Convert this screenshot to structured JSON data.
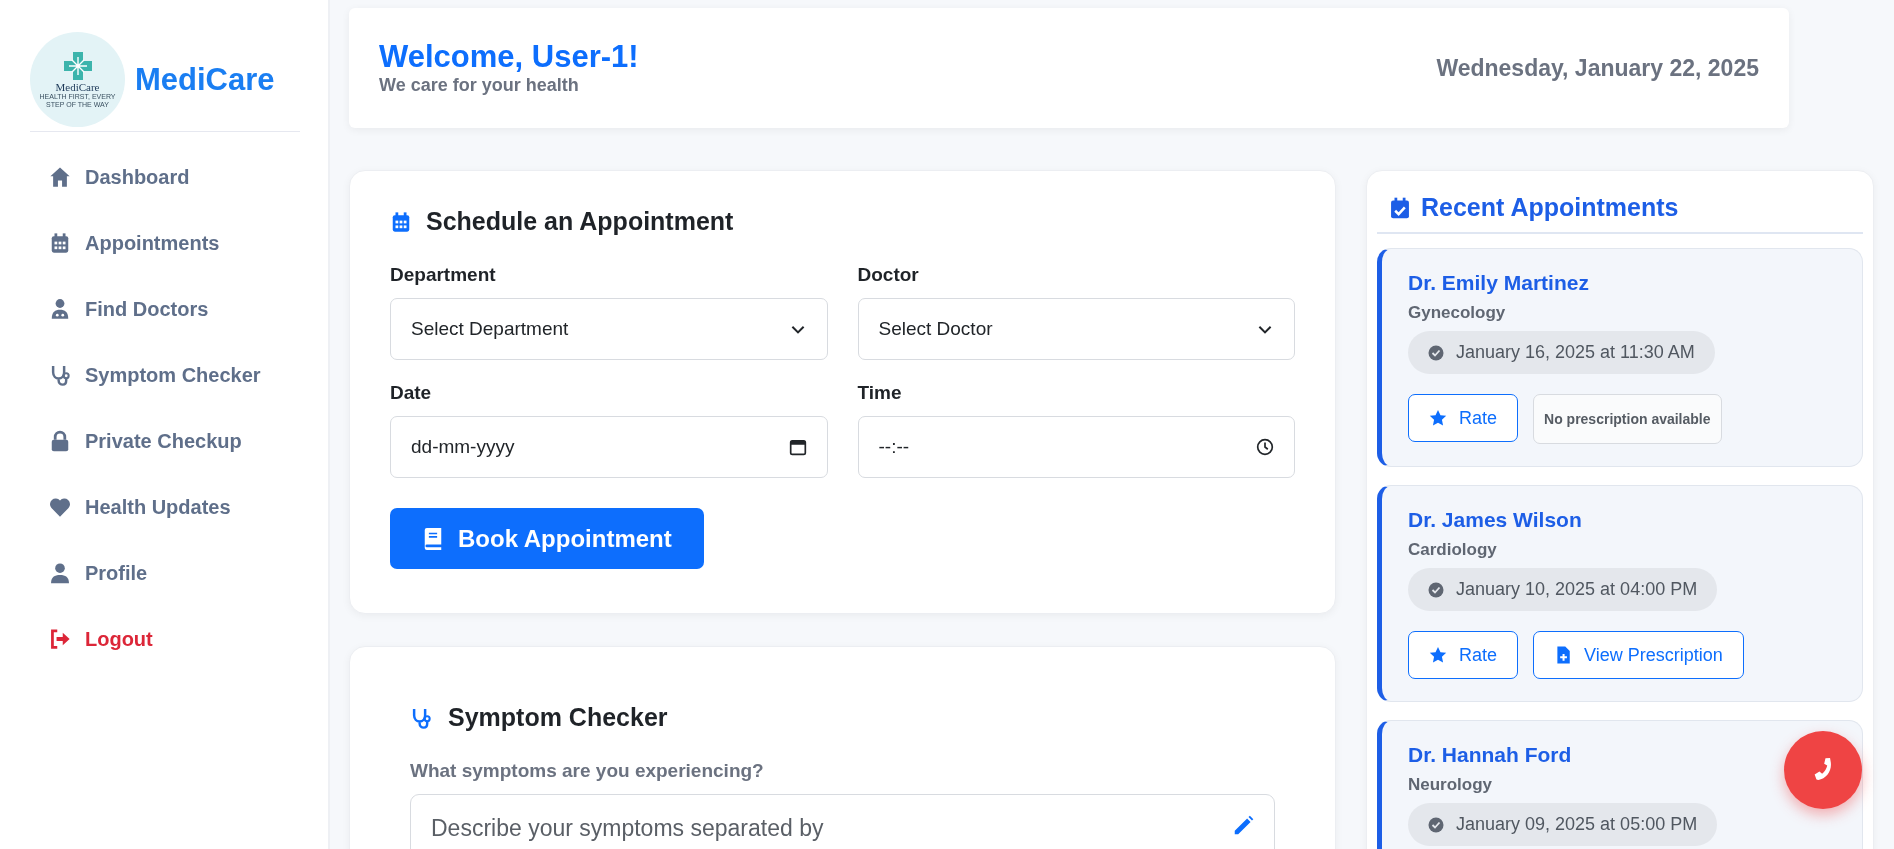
{
  "sidebar": {
    "brand": "MediCare",
    "logo": {
      "name": "MediCare",
      "tagline": "HEALTH FIRST, EVERY STEP OF THE WAY"
    },
    "items": [
      {
        "label": "Dashboard",
        "kind": "link"
      },
      {
        "label": "Appointments",
        "kind": "link"
      },
      {
        "label": "Find Doctors",
        "kind": "link"
      },
      {
        "label": "Symptom Checker",
        "kind": "link"
      },
      {
        "label": "Private Checkup",
        "kind": "link"
      },
      {
        "label": "Health Updates",
        "kind": "link"
      },
      {
        "label": "Profile",
        "kind": "link"
      },
      {
        "label": "Logout",
        "kind": "logout"
      }
    ]
  },
  "header": {
    "welcome": "Welcome, User-1!",
    "subtitle": "We care for your health",
    "date": "Wednesday, January 22, 2025"
  },
  "schedule": {
    "title": "Schedule an Appointment",
    "fields": [
      {
        "label": "Department",
        "kind": "select",
        "placeholder": "Select Department"
      },
      {
        "label": "Doctor",
        "kind": "select",
        "placeholder": "Select Doctor"
      },
      {
        "label": "Date",
        "kind": "date",
        "placeholder": "dd-mm-yyyy"
      },
      {
        "label": "Time",
        "kind": "time",
        "placeholder": "--:--"
      }
    ],
    "button": "Book Appointment"
  },
  "symptom_checker": {
    "title": "Symptom Checker",
    "label": "What symptoms are you experiencing?",
    "placeholder": "Describe your symptoms separated by"
  },
  "recent": {
    "title": "Recent Appointments",
    "appointments": [
      {
        "doctor": "Dr. Emily Martinez",
        "department": "Gynecology",
        "when": "January 16, 2025 at 11:30 AM",
        "rate": "Rate",
        "prescription": {
          "available": false,
          "label": "No prescription available"
        }
      },
      {
        "doctor": "Dr. James Wilson",
        "department": "Cardiology",
        "when": "January 10, 2025 at 04:00 PM",
        "rate": "Rate",
        "prescription": {
          "available": true,
          "label": "View Prescription"
        }
      },
      {
        "doctor": "Dr. Hannah Ford",
        "department": "Neurology",
        "when": "January 09, 2025 at 05:00 PM"
      }
    ]
  }
}
